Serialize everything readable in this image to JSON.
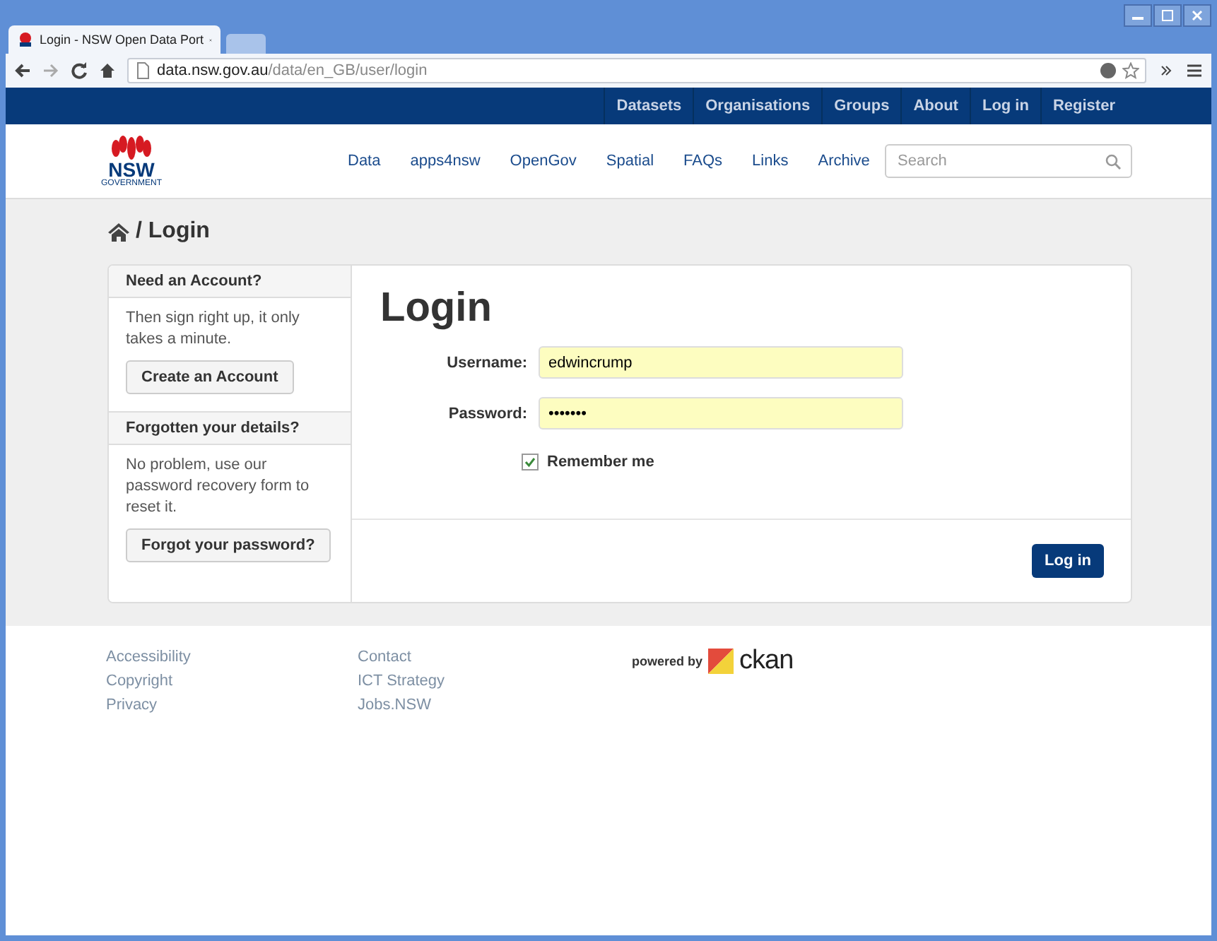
{
  "browser": {
    "tab_title": "Login - NSW Open Data Port",
    "url_host": "data.nsw.gov.au",
    "url_path": "/data/en_GB/user/login"
  },
  "top_nav": [
    "Datasets",
    "Organisations",
    "Groups",
    "About",
    "Log in",
    "Register"
  ],
  "logo": {
    "text": "NSW",
    "subtext": "GOVERNMENT"
  },
  "main_nav": [
    "Data",
    "apps4nsw",
    "OpenGov",
    "Spatial",
    "FAQs",
    "Links",
    "Archive"
  ],
  "search": {
    "placeholder": "Search"
  },
  "breadcrumb": "/ Login",
  "sidebar": [
    {
      "heading": "Need an Account?",
      "text": "Then sign right up, it only takes a minute.",
      "button": "Create an Account"
    },
    {
      "heading": "Forgotten your details?",
      "text": "No problem, use our password recovery form to reset it.",
      "button": "Forgot your password?"
    }
  ],
  "login": {
    "title": "Login",
    "fields": [
      {
        "label": "Username:",
        "value": "edwincrump"
      },
      {
        "label": "Password:",
        "value": "•••••••"
      }
    ],
    "remember": {
      "label": "Remember me",
      "checked": true
    },
    "submit": "Log in"
  },
  "footer": {
    "columns": [
      [
        "Accessibility",
        "Copyright",
        "Privacy"
      ],
      [
        "Contact",
        "ICT Strategy",
        "Jobs.NSW"
      ]
    ],
    "powered_by": "powered by",
    "brand": "ckan"
  }
}
